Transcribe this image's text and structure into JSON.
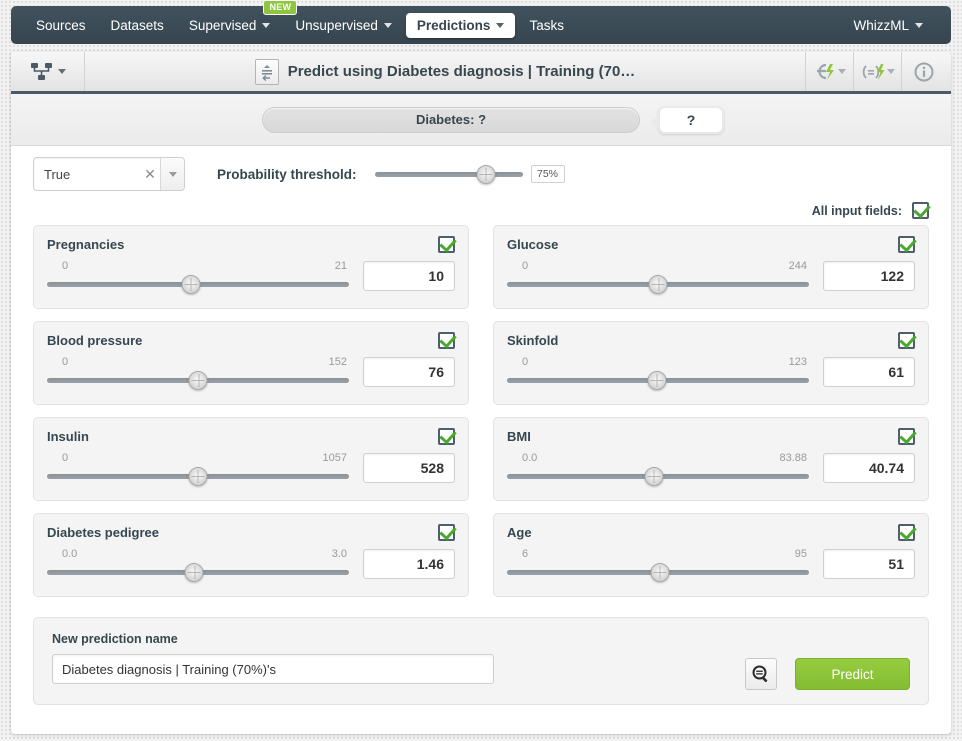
{
  "nav": {
    "items": [
      {
        "label": "Sources",
        "caret": false,
        "active": false,
        "badge": null
      },
      {
        "label": "Datasets",
        "caret": false,
        "active": false,
        "badge": null
      },
      {
        "label": "Supervised",
        "caret": true,
        "active": false,
        "badge": "NEW"
      },
      {
        "label": "Unsupervised",
        "caret": true,
        "active": false,
        "badge": null
      },
      {
        "label": "Predictions",
        "caret": true,
        "active": true,
        "badge": null
      },
      {
        "label": "Tasks",
        "caret": false,
        "active": false,
        "badge": null
      }
    ],
    "right": {
      "label": "WhizzML",
      "caret": true
    }
  },
  "header": {
    "model_icon": "decision-tree-icon",
    "doc_icon": "dataset-icon",
    "title": "Predict using Diabetes diagnosis | Training (70…",
    "actions": [
      {
        "icon": "cloud-lightning-icon",
        "caret": true
      },
      {
        "icon": "batch-lightning-icon",
        "caret": true
      },
      {
        "icon": "info-circle-icon",
        "caret": false
      }
    ]
  },
  "prediction_strip": {
    "objective_label": "Diabetes: ?",
    "bubble_value": "?"
  },
  "controls": {
    "class_select": {
      "value": "True",
      "clear_icon": "clear-x-icon"
    },
    "threshold_label": "Probability threshold:",
    "threshold_percent": 75,
    "threshold_display": "75%"
  },
  "all_fields": {
    "label": "All input fields:",
    "checked": true
  },
  "fields": [
    {
      "name": "Pregnancies",
      "min": "0",
      "max": "21",
      "value": "10",
      "percent": 47.6,
      "checked": true
    },
    {
      "name": "Glucose",
      "min": "0",
      "max": "244",
      "value": "122",
      "percent": 50.0,
      "checked": true
    },
    {
      "name": "Blood pressure",
      "min": "0",
      "max": "152",
      "value": "76",
      "percent": 50.0,
      "checked": true
    },
    {
      "name": "Skinfold",
      "min": "0",
      "max": "123",
      "value": "61",
      "percent": 49.6,
      "checked": true
    },
    {
      "name": "Insulin",
      "min": "0",
      "max": "1057",
      "value": "528",
      "percent": 49.9,
      "checked": true
    },
    {
      "name": "BMI",
      "min": "0.0",
      "max": "83.88",
      "value": "40.74",
      "percent": 48.6,
      "checked": true
    },
    {
      "name": "Diabetes pedigree",
      "min": "0.0",
      "max": "3.0",
      "value": "1.46",
      "percent": 48.7,
      "checked": true
    },
    {
      "name": "Age",
      "min": "6",
      "max": "95",
      "value": "51",
      "percent": 50.6,
      "checked": true
    }
  ],
  "footer": {
    "name_label": "New prediction name",
    "name_value": "Diabetes diagnosis | Training (70%)'s",
    "inspect_icon": "magnifier-icon",
    "predict_label": "Predict"
  },
  "colors": {
    "nav_bg": "#36454f",
    "accent_green": "#8ec63f",
    "predict_green": "#84bd32",
    "check_green": "#4aa82e",
    "text_dark": "#37474f"
  }
}
